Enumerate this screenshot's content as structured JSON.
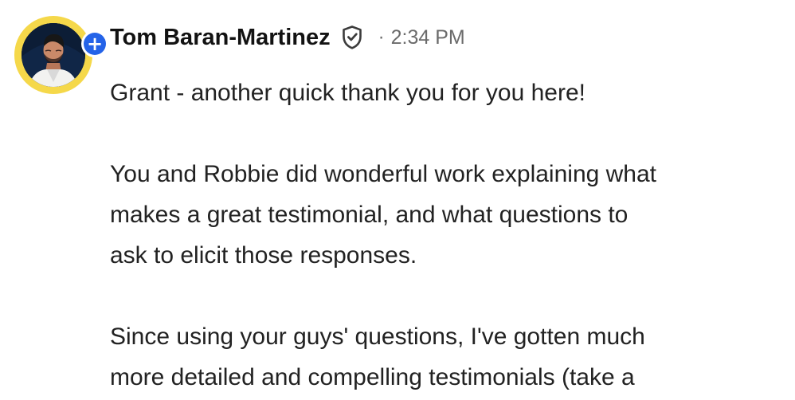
{
  "post": {
    "author": "Tom Baran-Martinez",
    "time": "2:34 PM",
    "separator": "·",
    "follow_symbol": "+",
    "paragraphs": [
      "Grant - another quick thank you for you here!",
      "You and Robbie did wonderful work explaining what\nmakes a great testimonial, and what questions to\nask to elicit those responses.",
      "Since using your guys' questions, I've gotten much\nmore detailed and compelling testimonials (take a"
    ]
  },
  "icons": {
    "avatar": "profile-photo",
    "follow": "plus-icon",
    "verified": "shield-check-icon"
  },
  "colors": {
    "avatar_ring": "#f5d84a",
    "follow_badge": "#2463e8",
    "text": "#222222",
    "muted": "#6b6b6b"
  }
}
